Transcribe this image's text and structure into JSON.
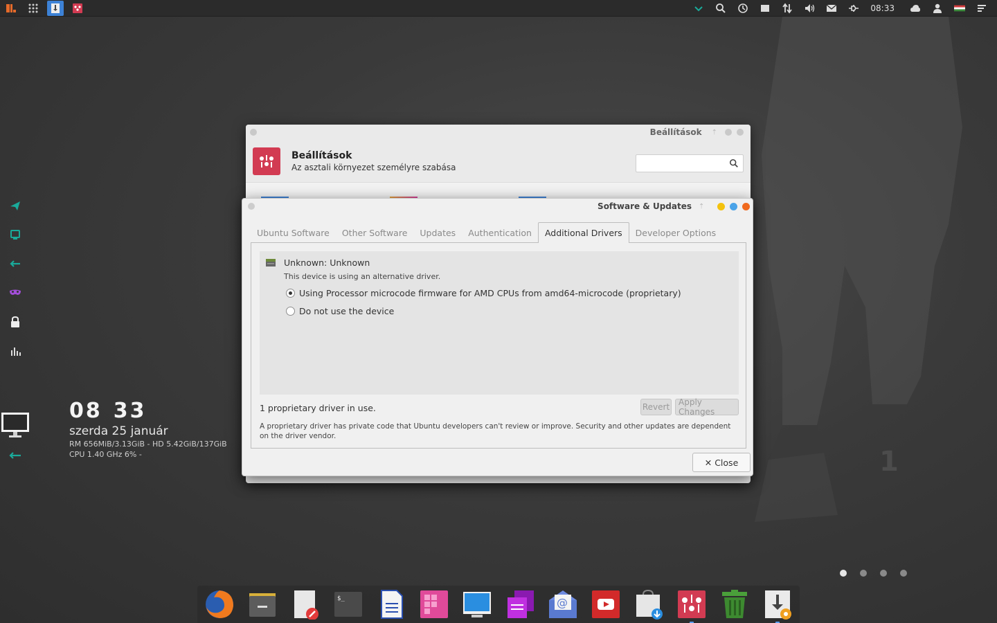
{
  "top_panel": {
    "clock": "08:33"
  },
  "conky": {
    "time_hours": "08",
    "time_minutes": "33",
    "date": "szerda 25 január",
    "ram_hd": "RM 656MiB/3.13GiB - HD 5.42GiB/137GiB",
    "cpu": "CPU 1.40 GHz 6% -"
  },
  "settings_window": {
    "titlebar": "Beállítások",
    "title": "Beállítások",
    "subtitle": "Az asztali környezet személyre szabása",
    "search_placeholder": ""
  },
  "software_updates": {
    "titlebar": "Software & Updates",
    "tabs": [
      {
        "label": "Ubuntu Software"
      },
      {
        "label": "Other Software"
      },
      {
        "label": "Updates"
      },
      {
        "label": "Authentication"
      },
      {
        "label": "Additional Drivers"
      },
      {
        "label": "Developer Options"
      }
    ],
    "active_tab": "Additional Drivers",
    "device": {
      "name": "Unknown: Unknown",
      "note": "This device is using an alternative driver.",
      "options": [
        {
          "label": "Using Processor microcode firmware for AMD CPUs from amd64-microcode (proprietary)",
          "checked": true
        },
        {
          "label": "Do not use the device",
          "checked": false
        }
      ]
    },
    "status": "1 proprietary driver in use.",
    "revert_label": "Revert",
    "apply_label": "Apply Changes",
    "note": "A proprietary driver has private code that Ubuntu developers can't review or improve. Security and other updates are dependent on the driver vendor.",
    "close_label": "Close"
  },
  "workspaces": 4,
  "active_workspace": 1,
  "colors": {
    "accent": "#3d82d6",
    "settings_red": "#d23b52",
    "teal": "#1aaa9a"
  },
  "dock_items": [
    "firefox-icon",
    "files-icon",
    "text-editor-icon",
    "terminal-icon",
    "writer-icon",
    "app-grid-icon",
    "display-icon",
    "notes-icon",
    "mail-icon",
    "youtube-icon",
    "store-icon",
    "settings-icon",
    "trash-icon",
    "software-updater-icon"
  ]
}
